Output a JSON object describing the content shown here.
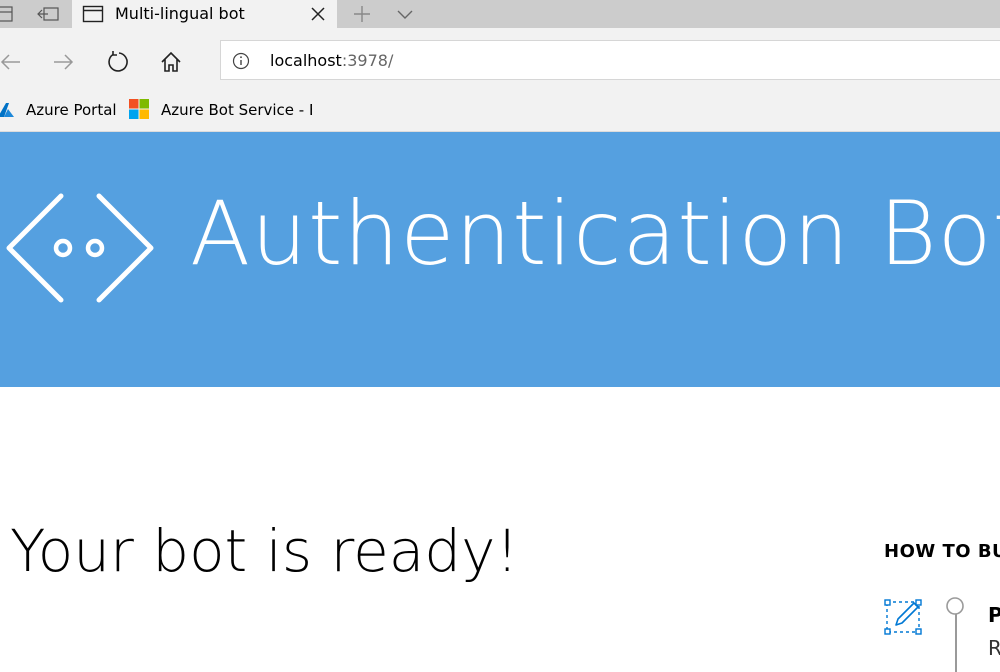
{
  "browser": {
    "tab": {
      "title": "Multi-lingual bot"
    },
    "address": {
      "host": "localhost",
      "path": ":3978/"
    },
    "favorites": [
      {
        "label": "Azure Portal",
        "icon": "azure-icon"
      },
      {
        "label": "Azure Bot Service - Bo",
        "icon": "microsoft-logo-icon"
      }
    ],
    "icons": [
      "tab-preview-icon",
      "set-aside-tabs-icon",
      "tab-page-icon",
      "close-icon",
      "new-tab-icon",
      "chevron-down-icon",
      "back-icon",
      "forward-icon",
      "refresh-icon",
      "home-icon",
      "info-icon"
    ]
  },
  "page": {
    "banner": {
      "title": "Authentication Bot",
      "color": "#55a0e0",
      "logo_icon": "bot-face-icon"
    },
    "heading": "Your bot is ready!",
    "howto": {
      "heading": "HOW TO BU",
      "step_icon": "edit-icon",
      "step_title": "P",
      "step_text": "R"
    }
  }
}
